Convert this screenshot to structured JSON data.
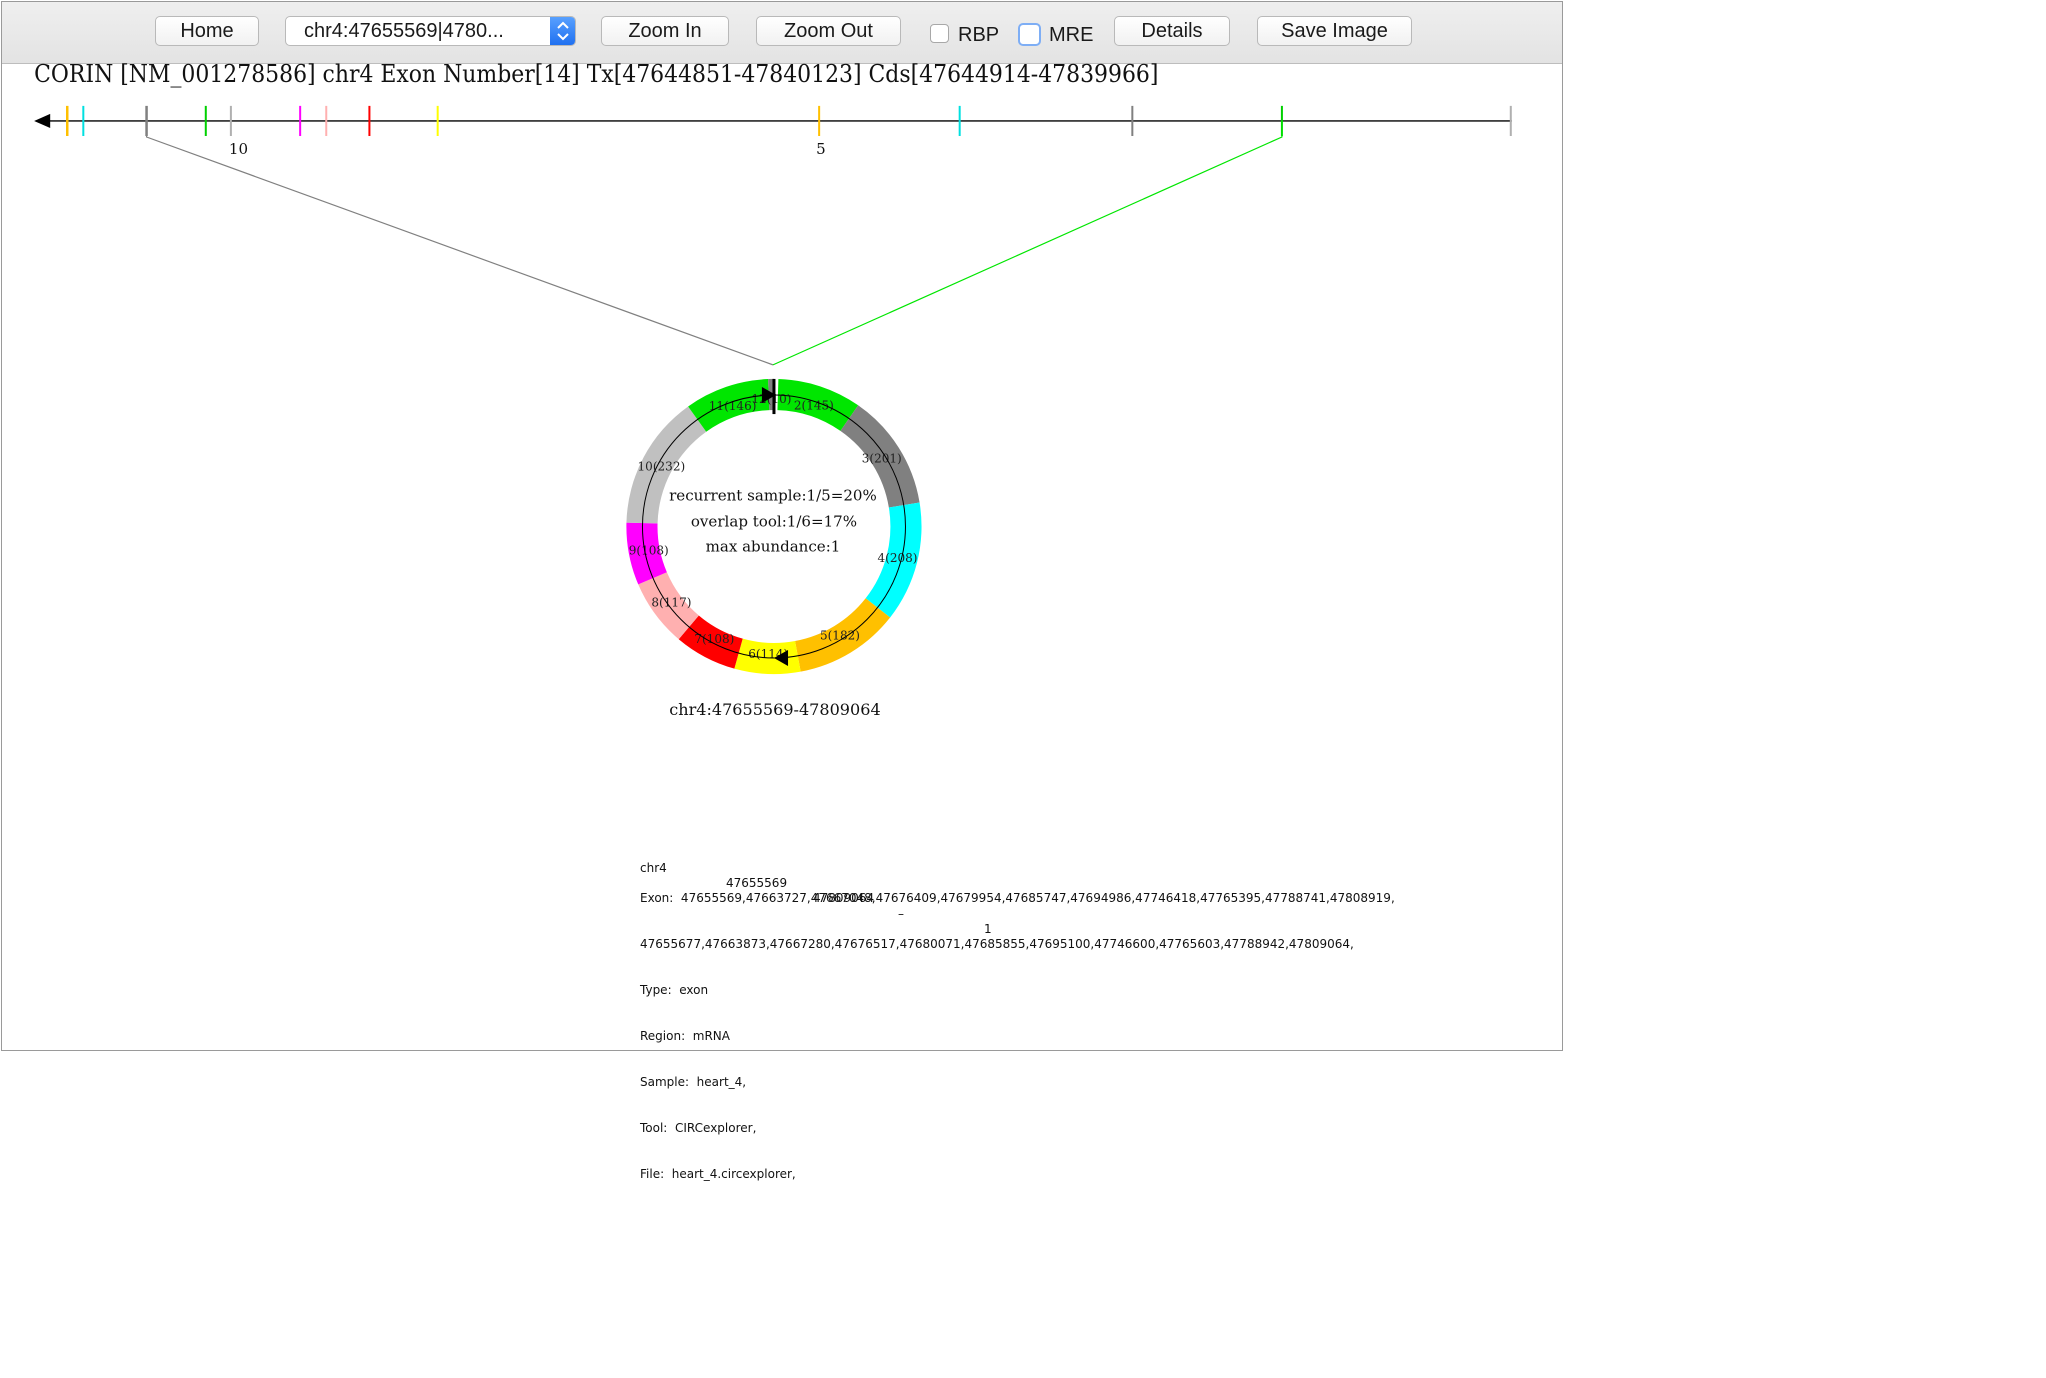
{
  "toolbar": {
    "home_label": "Home",
    "region_select_value": "chr4:47655569|4780...",
    "zoom_in_label": "Zoom In",
    "zoom_out_label": "Zoom Out",
    "rbp_label": "RBP",
    "mre_label": "MRE",
    "details_label": "Details",
    "save_image_label": "Save Image"
  },
  "gene": {
    "title": "CORIN [NM_001278586] chr4 Exon Number[14] Tx[47644851-47840123] Cds[47644914-47839966]",
    "exon_label_10": "10",
    "exon_label_5": "5"
  },
  "circle": {
    "recurrent_sample": "recurrent sample:1/5=20%",
    "overlap_tool": "overlap tool:1/6=17%",
    "max_abundance": "max abundance:1",
    "coordinates": "chr4:47655569-47809064",
    "segments": [
      {
        "label": "2(145)",
        "color": "#00e600"
      },
      {
        "label": "3(201)",
        "color": "#808080"
      },
      {
        "label": "4(208)",
        "color": "#00ffff"
      },
      {
        "label": "5(182)",
        "color": "#ffc000"
      },
      {
        "label": "6(114)",
        "color": "#ffff00"
      },
      {
        "label": "7(108)",
        "color": "#ff0000"
      },
      {
        "label": "8(117)",
        "color": "#ffb0b0"
      },
      {
        "label": "9(108)",
        "color": "#ff00ff"
      },
      {
        "label": "10(232)",
        "color": "#c0c0c0"
      },
      {
        "label": "11(146)",
        "color": "#00e600"
      },
      {
        "label": "12(10)",
        "color": "#808080"
      }
    ]
  },
  "details": {
    "line1_chr": "chr4",
    "line1_start": "47655569",
    "line1_end": "47809064",
    "line1_strand": "–",
    "line1_count": "1",
    "exon_line1": "Exon:  47655569,47663727,47667048,47676409,47679954,47685747,47694986,47746418,47765395,47788741,47808919,",
    "exon_line2": "47655677,47663873,47667280,47676517,47680071,47685855,47695100,47746600,47765603,47788942,47809064,",
    "type": "Type:  exon",
    "region": "Region:  mRNA",
    "sample": "Sample:  heart_4,",
    "tool": "Tool:  CIRCexplorer,",
    "file": "File:  heart_4.circexplorer,"
  },
  "colors": {
    "toolbar_bg": "#e8e8e8",
    "select_accent": "#1e6ff0",
    "track_line": "#000000",
    "zoom_line_left": "#808080",
    "zoom_line_right": "#00e600"
  }
}
